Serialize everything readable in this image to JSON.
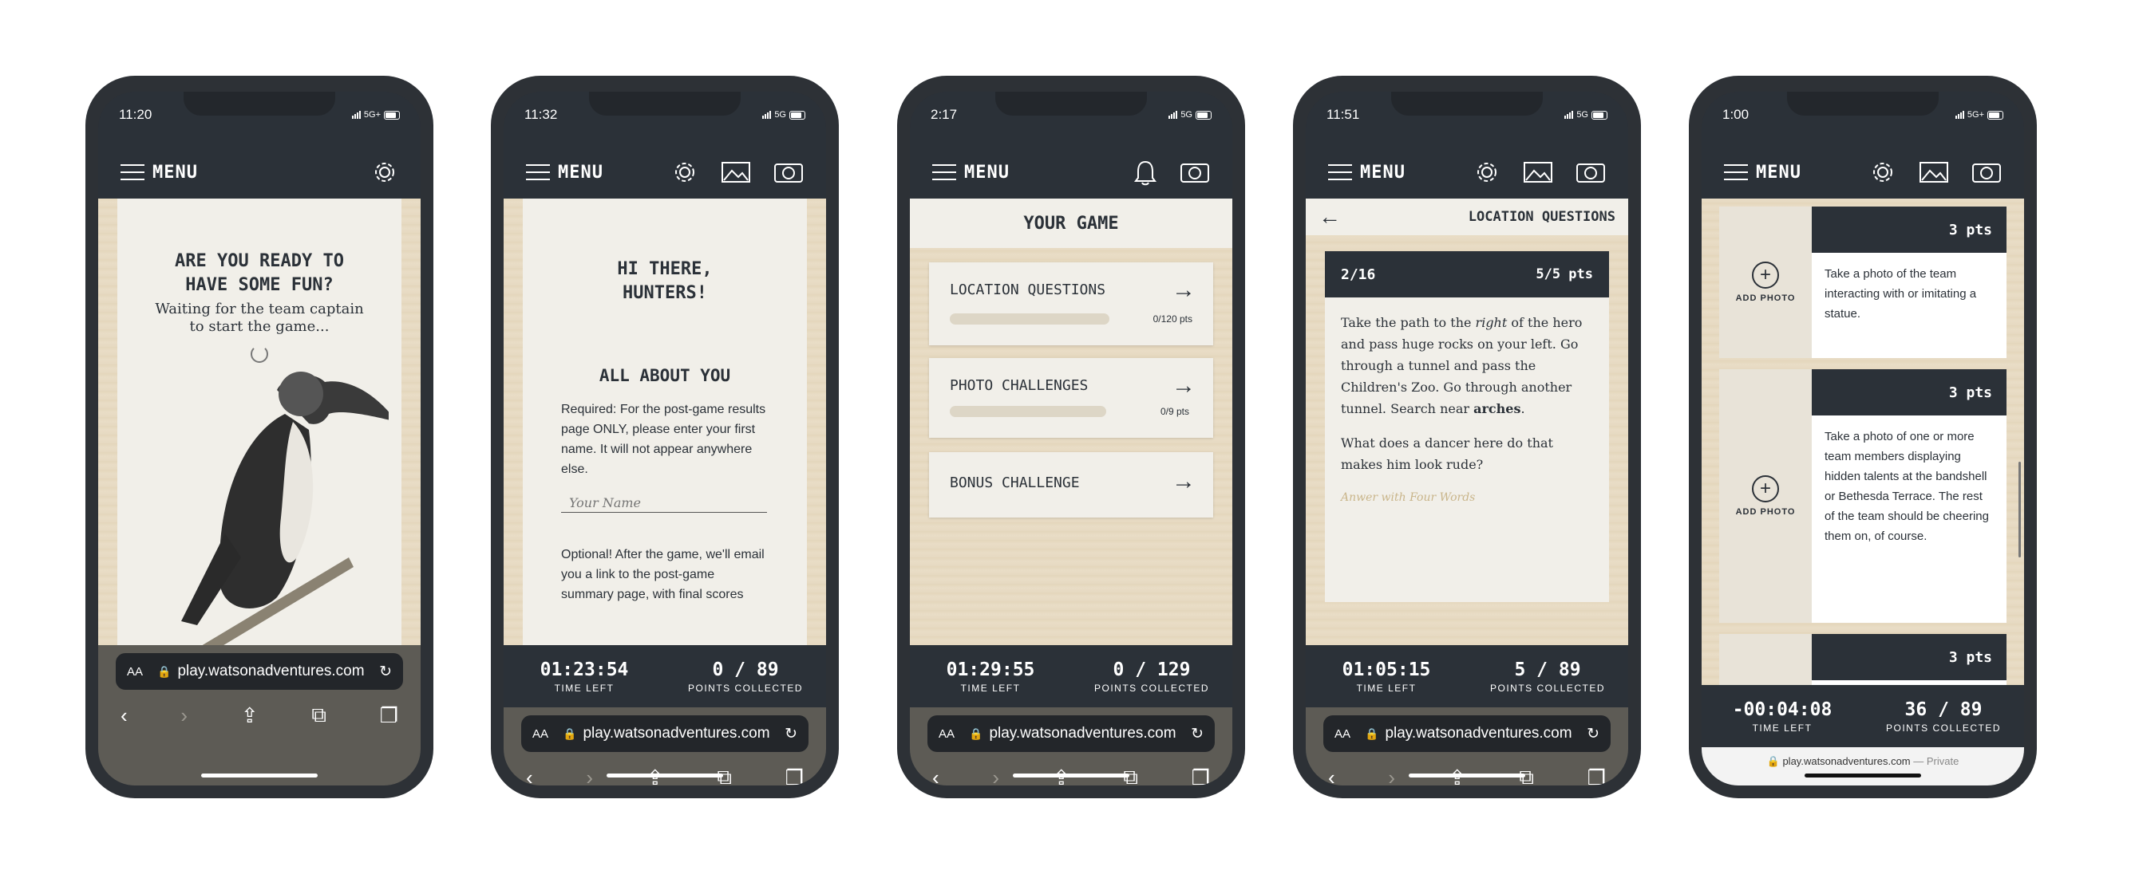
{
  "phones": [
    {
      "time": "11:20",
      "network": "5G+",
      "menu_label": "MENU",
      "heading": "ARE YOU READY TO HAVE SOME FUN?",
      "subtext": "Waiting for the team captain to start the game...",
      "url": "play.watsonadventures.com",
      "aa": "AA"
    },
    {
      "time": "11:32",
      "network": "5G",
      "menu_label": "MENU",
      "greeting": "HI THERE, HUNTERS!",
      "section": "ALL ABOUT YOU",
      "required_text": "Required: For the post-game results page ONLY, please enter your first name. It will not appear anywhere else.",
      "name_placeholder": "Your Name",
      "optional_text": "Optional! After the game, we'll email you a link to the post-game summary page, with final scores",
      "time_left": "01:23:54",
      "time_left_label": "TIME LEFT",
      "points": "0 / 89",
      "points_label": "POINTS COLLECTED",
      "url": "play.watsonadventures.com",
      "aa": "AA"
    },
    {
      "time": "2:17",
      "network": "5G",
      "menu_label": "MENU",
      "title": "YOUR GAME",
      "items": [
        {
          "label": "LOCATION QUESTIONS",
          "score": "0/120 pts",
          "progress": 0
        },
        {
          "label": "PHOTO CHALLENGES",
          "score": "0/9 pts",
          "progress": 0
        },
        {
          "label": "BONUS CHALLENGE",
          "score": "",
          "progress": null
        }
      ],
      "time_left": "01:29:55",
      "time_left_label": "TIME LEFT",
      "points": "0 / 129",
      "points_label": "POINTS COLLECTED",
      "url": "play.watsonadventures.com",
      "aa": "AA"
    },
    {
      "time": "11:51",
      "network": "5G",
      "menu_label": "MENU",
      "title": "LOCATION QUESTIONS",
      "counter": "2/16",
      "pts": "5/5 pts",
      "question_a": "Take the path to the ",
      "question_em": "right",
      "question_b": " of the hero and pass huge rocks on your left. Go through a tunnel and pass the Children's Zoo. Go through another tunnel. Search near ",
      "question_strong": "arches",
      "question_c": ".",
      "prompt": "What does a dancer here do that makes him look rude?",
      "answer": "Anwer with Four Words",
      "time_left": "01:05:15",
      "time_left_label": "TIME LEFT",
      "points": "5 / 89",
      "points_label": "POINTS COLLECTED",
      "url": "play.watsonadventures.com",
      "aa": "AA"
    },
    {
      "time": "1:00",
      "network": "5G+",
      "menu_label": "MENU",
      "challenges": [
        {
          "pts": "3 pts",
          "add_label": "ADD PHOTO",
          "text": "Take a photo of the team interacting with or imitating a statue."
        },
        {
          "pts": "3 pts",
          "add_label": "ADD PHOTO",
          "text": "Take a photo of one or more team members displaying hidden talents at the bandshell or Bethesda Terrace. The rest of the team should be cheering them on, of course."
        },
        {
          "pts": "3 pts"
        }
      ],
      "time_left": "-00:04:08",
      "time_left_label": "TIME LEFT",
      "points": "36 / 89",
      "points_label": "POINTS COLLECTED",
      "url": "play.watsonadventures.com",
      "url_suffix": "— Private"
    }
  ],
  "colors": {
    "frame": "#2d3136",
    "navy": "#2b3138",
    "paper": "#e8dcc6",
    "card": "#f1efe9",
    "accent_gold": "#c9b58a"
  }
}
